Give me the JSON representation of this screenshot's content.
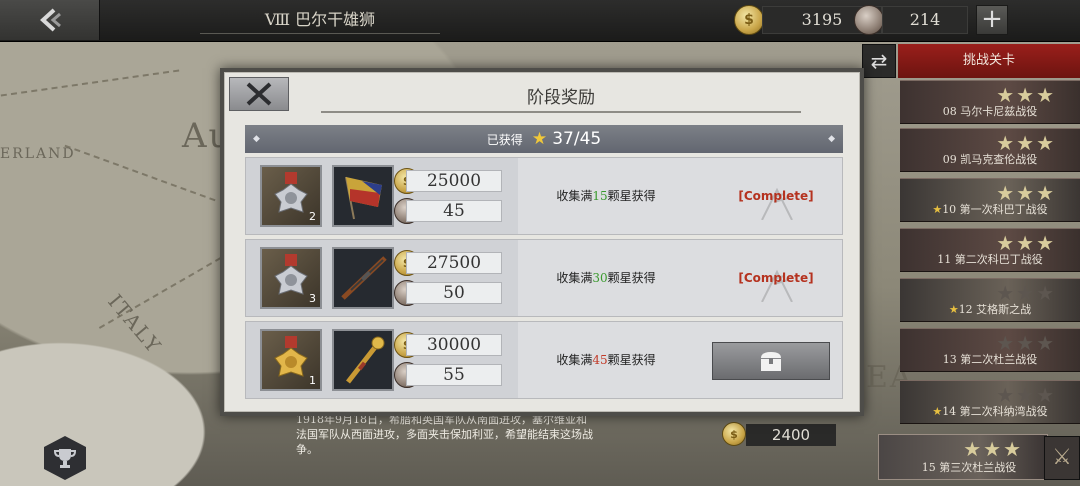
{
  "header": {
    "stage_title": "Ⅷ 巴尔干雄狮",
    "coins": "3195",
    "medals": "214",
    "plus": "+"
  },
  "map": {
    "labels": [
      "ERLAND",
      "Au",
      "ITALY",
      "EA"
    ]
  },
  "challenge_panel": {
    "swap_icon": "⇄",
    "tab_label": "挑战关卡",
    "stages": [
      {
        "name": "08 马尔卡尼兹战役",
        "stars": 3,
        "has_star_mark": false
      },
      {
        "name": "09 凯马克查伦战役",
        "stars": 3,
        "has_star_mark": false
      },
      {
        "name": "10 第一次科巴丁战役",
        "stars": 3,
        "has_star_mark": true
      },
      {
        "name": "11 第二次科巴丁战役",
        "stars": 3,
        "has_star_mark": false
      },
      {
        "name": "12 艾格斯之战",
        "stars": 3,
        "has_star_mark": true
      },
      {
        "name": "13 第二次杜兰战役",
        "stars": 3,
        "has_star_mark": false
      },
      {
        "name": "14 第二次科纳湾战役",
        "stars": 3,
        "has_star_mark": true
      },
      {
        "name": "15 第三次杜兰战役",
        "stars": 3,
        "has_star_mark": false
      }
    ],
    "star_glyphs": "★★★",
    "mini_star": "★",
    "cross_icon": "⚔"
  },
  "story_text": "1918年9月18日，希腊和英国军队从南面进攻，塞尔维亚和法国军队从西面进攻，多面夹击保加利亚，希望能结束这场战争。",
  "bottom_coin_value": "2400",
  "modal": {
    "title": "阶段奖励",
    "earned_label": "已获得",
    "star_glyph": "★",
    "earned_value": "37/45",
    "diamond": "◆",
    "coin_glyph": "$",
    "rewards": [
      {
        "medal_count": "2",
        "coins": "25000",
        "medals": "45",
        "req_prefix": "收集满",
        "req_num": "15",
        "req_suffix": "颗星获得",
        "status": "[Complete]"
      },
      {
        "medal_count": "3",
        "coins": "27500",
        "medals": "50",
        "req_prefix": "收集满",
        "req_num": "30",
        "req_suffix": "颗星获得",
        "status": "[Complete]"
      },
      {
        "medal_count": "1",
        "coins": "30000",
        "medals": "55",
        "req_prefix": "收集满",
        "req_num": "45",
        "req_suffix": "颗星获得",
        "status": ""
      }
    ]
  }
}
